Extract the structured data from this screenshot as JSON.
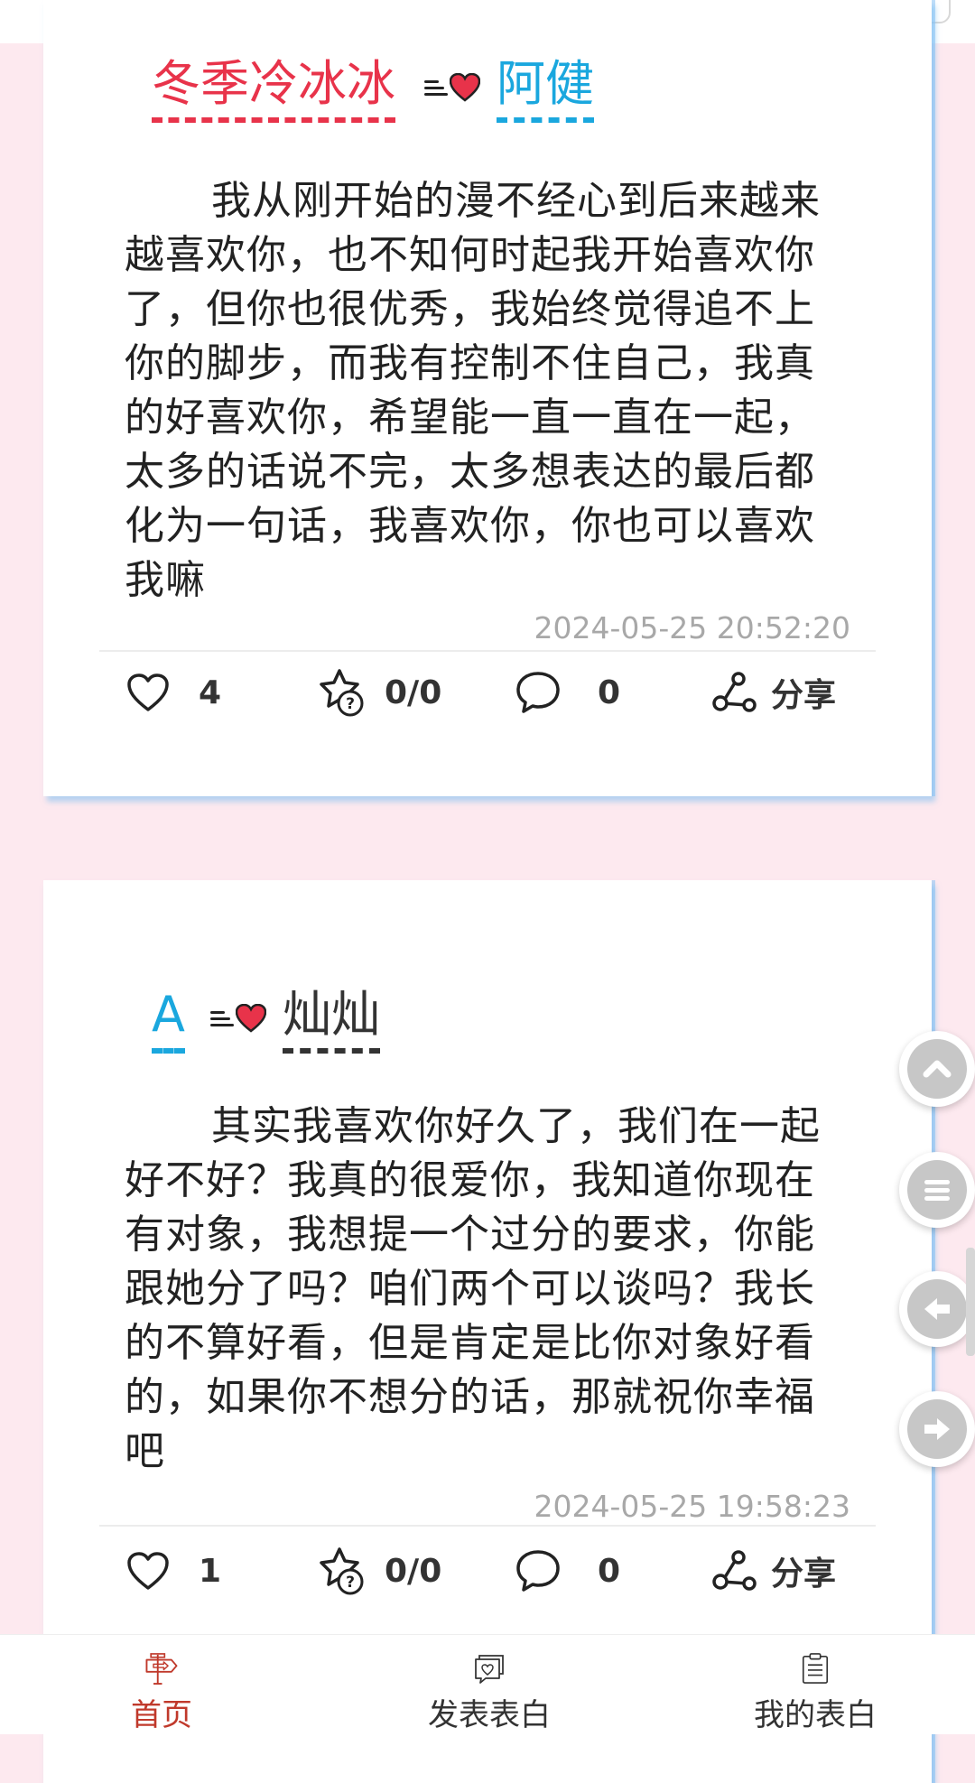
{
  "header": {
    "left_text": "",
    "right_button_label": ""
  },
  "posts": [
    {
      "from": "冬季冷冰冰",
      "to": "阿健",
      "content": "我从刚开始的漫不经心到后来越来越喜欢你，也不知何时起我开始喜欢你了，但你也很优秀，我始终觉得追不上你的脚步，而我有控制不住自己，我真的好喜欢你，希望能一直一直在一起，太多的话说不完，太多想表达的最后都化为一句话，我喜欢你，你也可以喜欢我嘛",
      "timestamp": "2024-05-25 20:52:20",
      "likes": "4",
      "guess": "0/0",
      "comments": "0",
      "share_label": "分享"
    },
    {
      "from": "A",
      "to": "灿灿",
      "content": "其实我喜欢你好久了，我们在一起好不好？我真的很爱你，我知道你现在有对象，我想提一个过分的要求，你能跟她分了吗？咱们两个可以谈吗？我长的不算好看，但是肯定是比你对象好看的，如果你不想分的话，那就祝你幸福吧",
      "timestamp": "2024-05-25 19:58:23",
      "likes": "1",
      "guess": "0/0",
      "comments": "0",
      "share_label": "分享"
    }
  ],
  "side_buttons": [
    "scroll-up-icon",
    "menu-icon",
    "back-arrow-icon",
    "forward-arrow-icon"
  ],
  "bottom_nav": {
    "items": [
      {
        "icon": "signpost-icon",
        "label": "首页"
      },
      {
        "icon": "heart-message-icon",
        "label": "发表表白"
      },
      {
        "icon": "clipboard-icon",
        "label": "我的表白"
      }
    ]
  },
  "colors": {
    "background": "#fde9ef",
    "name_red": "#e8334a",
    "name_blue": "#1aa7de",
    "nav_active": "#c0392b",
    "heart": "#e8334a"
  }
}
